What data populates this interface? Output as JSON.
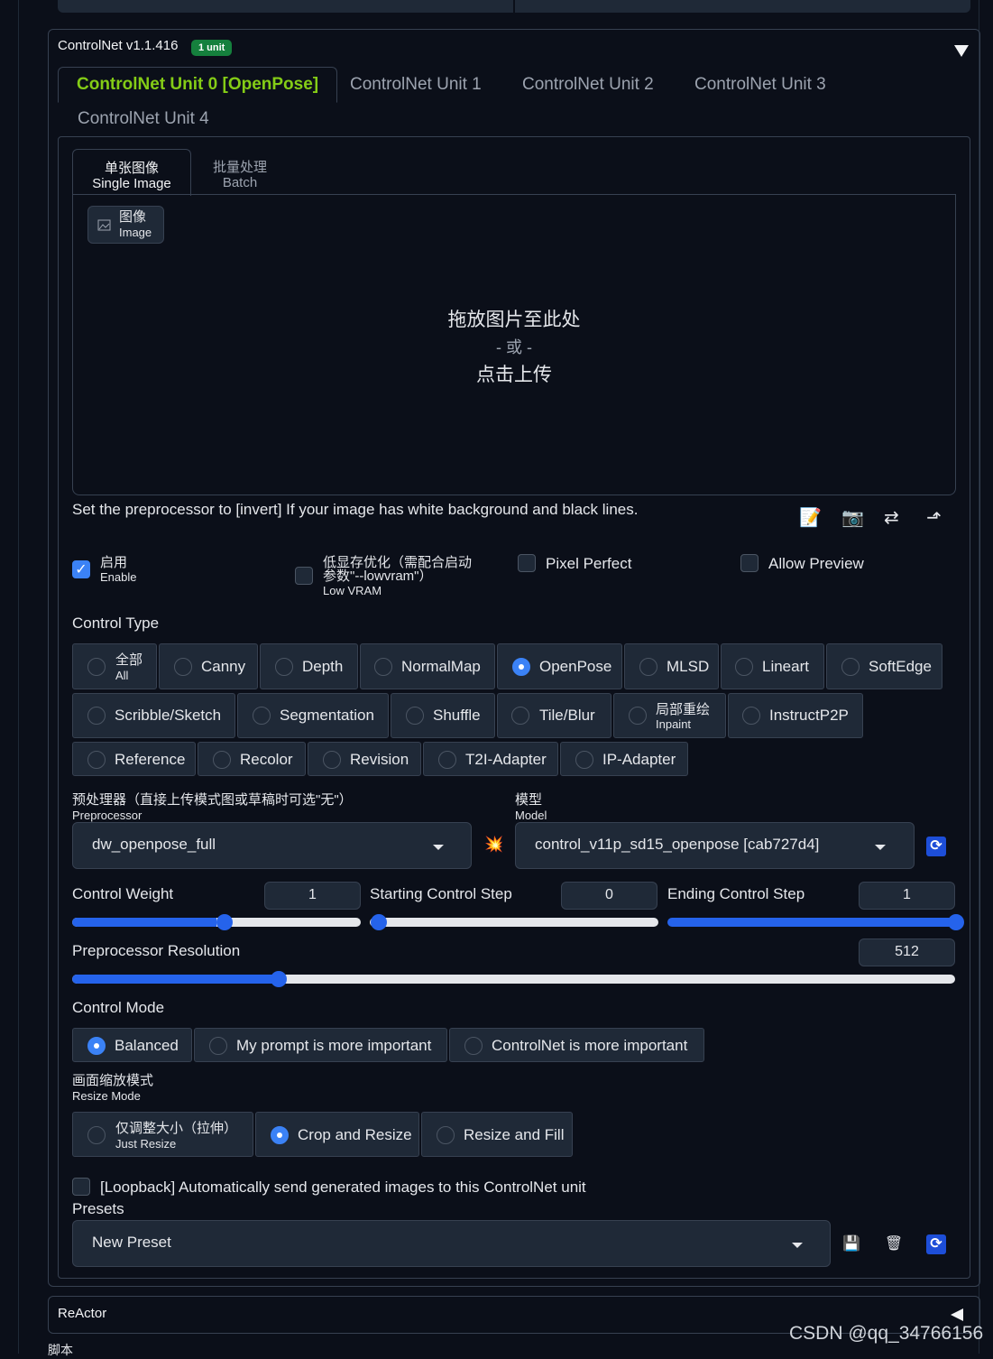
{
  "accordion": {
    "title": "ControlNet v1.1.416",
    "badge": "1 unit"
  },
  "unit_tabs": [
    "ControlNet Unit 0 [OpenPose]",
    "ControlNet Unit 1",
    "ControlNet Unit 2",
    "ControlNet Unit 3",
    "ControlNet Unit 4"
  ],
  "sub_tabs": [
    {
      "cn": "单张图像",
      "en": "Single Image"
    },
    {
      "cn": "批量处理",
      "en": "Batch"
    }
  ],
  "image_label": {
    "cn": "图像",
    "en": "Image"
  },
  "drop": {
    "line1": "拖放图片至此处",
    "line2": "- 或 -",
    "line3": "点击上传"
  },
  "hint": "Set the preprocessor to [invert] If your image has white background and black lines.",
  "tools": [
    "📝",
    "📷",
    "⇄",
    "⬏"
  ],
  "checkboxes": {
    "enable": {
      "cn": "启用",
      "en": "Enable",
      "checked": true
    },
    "lowvram": {
      "cn1": "低显存优化（需配合启动",
      "cn2": "参数\"--lowvram\"）",
      "en": "Low VRAM",
      "checked": false
    },
    "pixel_perfect": {
      "label": "Pixel Perfect",
      "checked": false
    },
    "allow_preview": {
      "label": "Allow Preview",
      "checked": false
    }
  },
  "control_type": {
    "label": "Control Type",
    "selected": "OpenPose",
    "row1": [
      {
        "cn": "全部",
        "en": "All"
      },
      {
        "label": "Canny"
      },
      {
        "label": "Depth"
      },
      {
        "label": "NormalMap"
      },
      {
        "label": "OpenPose"
      },
      {
        "label": "MLSD"
      },
      {
        "label": "Lineart"
      },
      {
        "label": "SoftEdge"
      }
    ],
    "row2": [
      {
        "label": "Scribble/Sketch"
      },
      {
        "label": "Segmentation"
      },
      {
        "label": "Shuffle"
      },
      {
        "label": "Tile/Blur"
      },
      {
        "cn": "局部重绘",
        "en": "Inpaint"
      },
      {
        "label": "InstructP2P"
      }
    ],
    "row3": [
      {
        "label": "Reference"
      },
      {
        "label": "Recolor"
      },
      {
        "label": "Revision"
      },
      {
        "label": "T2I-Adapter"
      },
      {
        "label": "IP-Adapter"
      }
    ]
  },
  "preprocessor": {
    "cn": "预处理器（直接上传模式图或草稿时可选\"无\"）",
    "en": "Preprocessor",
    "value": "dw_openpose_full"
  },
  "run_icon": "💥",
  "model": {
    "cn": "模型",
    "en": "Model",
    "value": "control_v11p_sd15_openpose [cab727d4]"
  },
  "refresh_icon": "⟳",
  "sliders": {
    "control_weight": {
      "label": "Control Weight",
      "value": "1",
      "fraction": 0.5
    },
    "starting_step": {
      "label": "Starting Control Step",
      "value": "0",
      "fraction": 0.0
    },
    "ending_step": {
      "label": "Ending Control Step",
      "value": "1",
      "fraction": 1.0
    },
    "resolution": {
      "label": "Preprocessor Resolution",
      "value": "512",
      "fraction": 0.232
    }
  },
  "control_mode": {
    "label": "Control Mode",
    "options": [
      "Balanced",
      "My prompt is more important",
      "ControlNet is more important"
    ],
    "selected": "Balanced"
  },
  "resize_mode": {
    "cn": "画面缩放模式",
    "en": "Resize Mode",
    "opt1_cn": "仅调整大小（拉伸）",
    "opt1_en": "Just Resize",
    "options": [
      "Crop and Resize",
      "Resize and Fill"
    ],
    "selected": "Crop and Resize"
  },
  "loopback": {
    "label": "[Loopback] Automatically send generated images to this ControlNet unit",
    "checked": false
  },
  "presets": {
    "label": "Presets",
    "value": "New Preset",
    "save_icon": "💾",
    "delete_icon": "🗑"
  },
  "reactor": {
    "title": "ReActor"
  },
  "scripts_label": "脚本",
  "watermark": "CSDN @qq_34766156",
  "colors": {
    "accent": "#2563eb",
    "active_tab": "#84cc16",
    "badge": "#15803d",
    "bg": "#0b0f19"
  }
}
